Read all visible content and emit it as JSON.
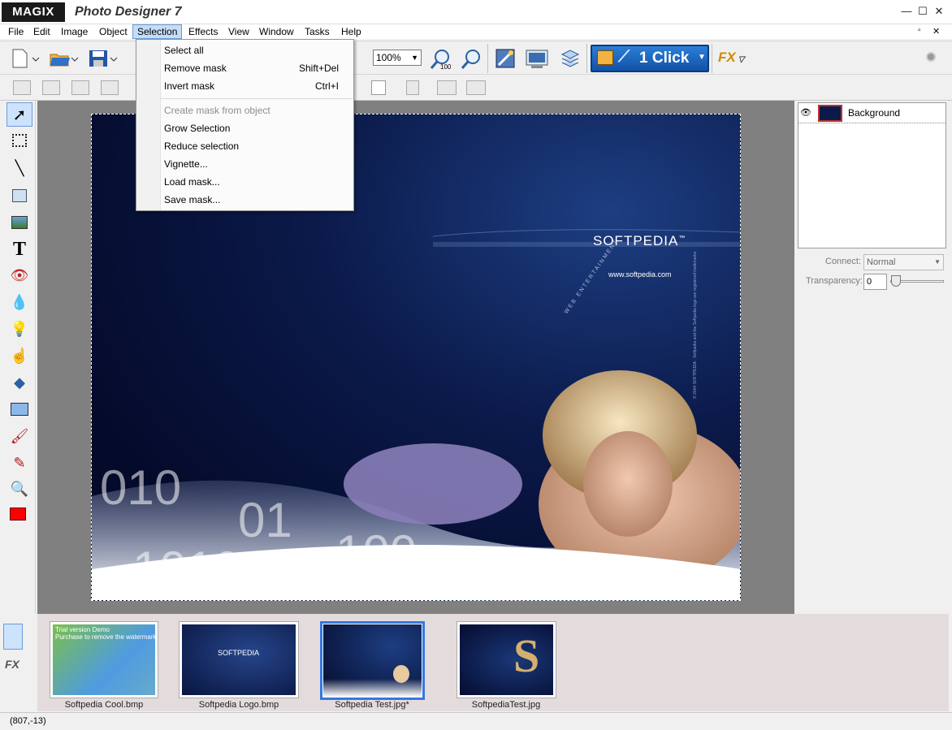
{
  "app": {
    "logo": "MAGIX",
    "title": "Photo Designer 7"
  },
  "window_controls": {
    "minimize": "—",
    "maximize": "☐",
    "close": "✕",
    "restore": "▫",
    "close2": "✕"
  },
  "menu": [
    "File",
    "Edit",
    "Image",
    "Object",
    "Selection",
    "Effects",
    "View",
    "Window",
    "Tasks",
    "Help"
  ],
  "active_menu": "Selection",
  "selection_menu": {
    "items": [
      {
        "label": "Select all",
        "shortcut": ""
      },
      {
        "label": "Remove mask",
        "shortcut": "Shift+Del"
      },
      {
        "label": "Invert mask",
        "shortcut": "Ctrl+I"
      },
      {
        "label": "Create mask from object",
        "shortcut": "",
        "disabled": true
      },
      {
        "label": "Grow Selection",
        "shortcut": ""
      },
      {
        "label": "Reduce selection",
        "shortcut": ""
      },
      {
        "label": "Vignette...",
        "shortcut": ""
      },
      {
        "label": "Load mask...",
        "shortcut": ""
      },
      {
        "label": "Save mask...",
        "shortcut": ""
      }
    ]
  },
  "toolbar": {
    "zoom": "100%",
    "one_click": "1 Click",
    "fx": "FX"
  },
  "layers": {
    "name": "Background"
  },
  "layer_props": {
    "connect_label": "Connect:",
    "connect_value": "Normal",
    "transparency_label": "Transparency:",
    "transparency_value": "0"
  },
  "canvas_text": {
    "brand": "SOFTPEDIA",
    "tm": "™",
    "url": "www.softpedia.com",
    "arc": "WEB ENTERTAINMENT",
    "side": "© 2004 SOFTPEDIA · Softpedia and the Softpedia logo are registered trademarks"
  },
  "thumbnails": [
    {
      "label": "Softpedia Cool.bmp",
      "overlay": "Trial version Demo\nPurchase to remove the watermark"
    },
    {
      "label": "Softpedia Logo.bmp",
      "overlay": "SOFTPEDIA"
    },
    {
      "label": "Softpedia Test.jpg*",
      "overlay": ""
    },
    {
      "label": "SoftpediaTest.jpg",
      "overlay": "S"
    }
  ],
  "status": {
    "coords": "(807,-13)"
  },
  "colors": {
    "foreground": "#ff0000",
    "accent": "#3478e0"
  }
}
